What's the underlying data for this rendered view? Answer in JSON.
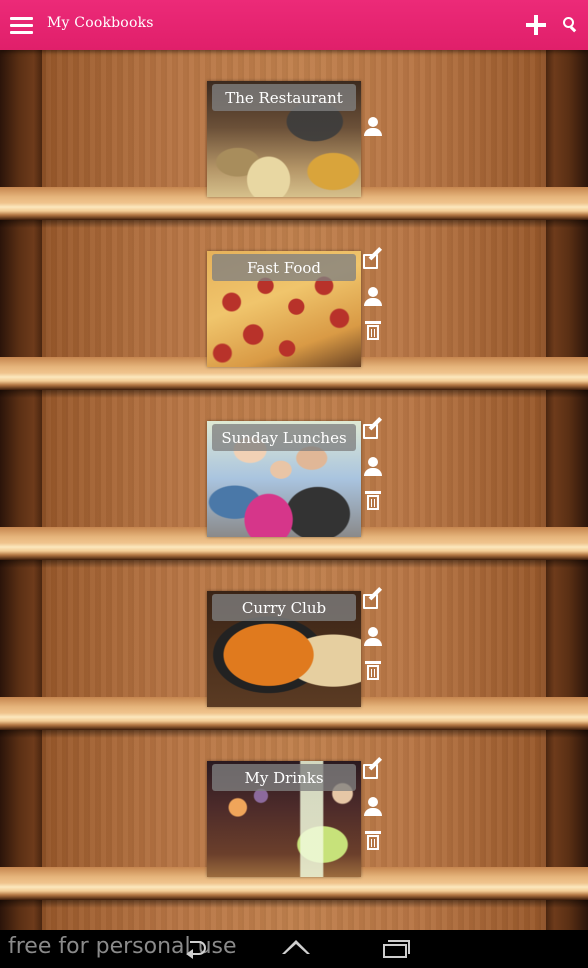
{
  "app_bar": {
    "title": "My Cookbooks",
    "menu_icon": "hamburger-menu-icon",
    "add_icon": "plus-icon",
    "search_icon": "search-icon",
    "color": "#e8266f"
  },
  "cookbooks": [
    {
      "title": "The Restaurant",
      "image": "restaurant-kitchen-photo",
      "actions": [
        "owner"
      ]
    },
    {
      "title": "Fast Food",
      "image": "pizza-photo",
      "actions": [
        "edit",
        "owner",
        "delete"
      ]
    },
    {
      "title": "Sunday Lunches",
      "image": "family-photo",
      "actions": [
        "edit",
        "owner",
        "delete"
      ]
    },
    {
      "title": "Curry Club",
      "image": "curry-photo",
      "actions": [
        "edit",
        "owner",
        "delete"
      ]
    },
    {
      "title": "My Drinks",
      "image": "cocktail-photo",
      "actions": [
        "edit",
        "owner",
        "delete"
      ]
    }
  ],
  "action_icons": {
    "edit": "edit-icon",
    "owner": "person-icon",
    "delete": "trash-icon"
  },
  "nav_bar": {
    "watermark": "free for personal use",
    "back_icon": "back-icon",
    "home_icon": "home-icon",
    "recents_icon": "recent-apps-icon"
  }
}
